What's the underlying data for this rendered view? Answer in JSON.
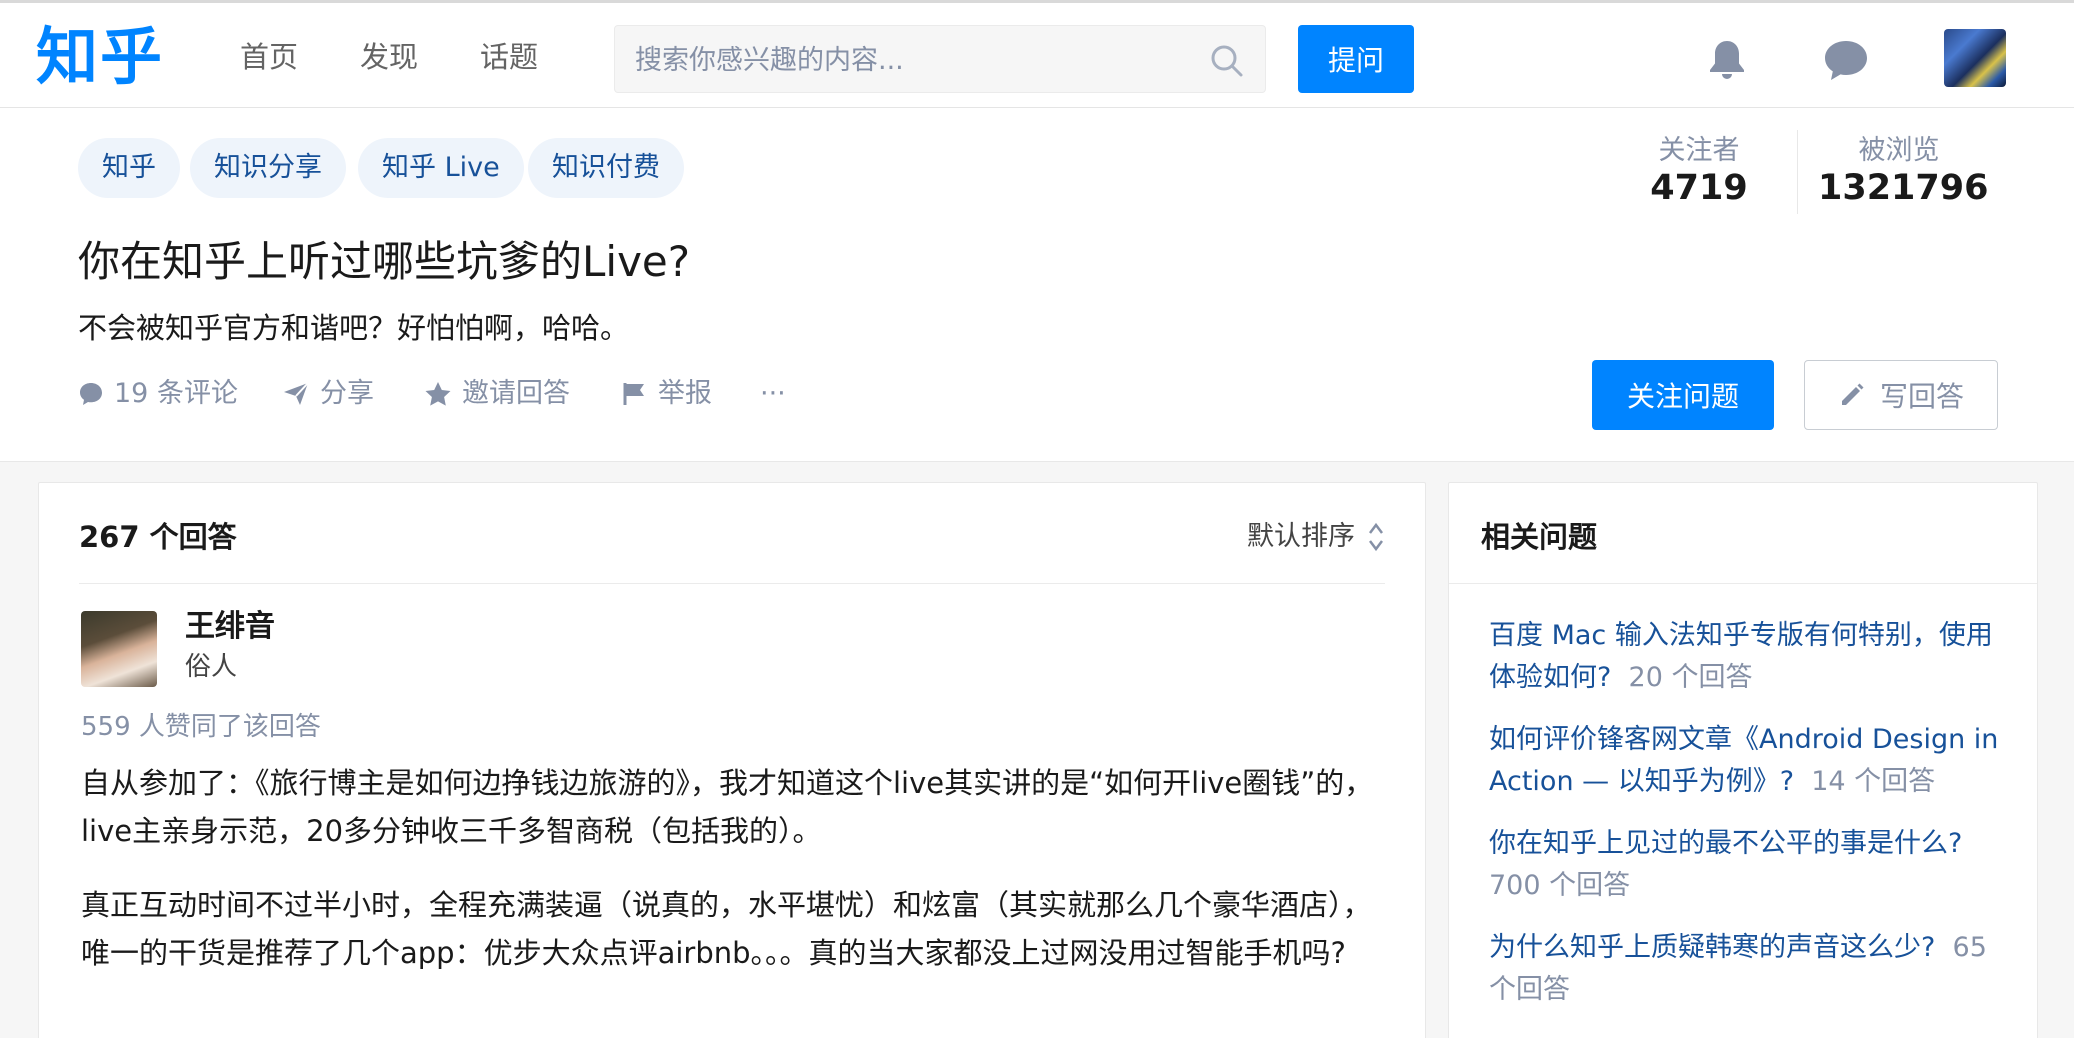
{
  "header": {
    "logo": "知乎",
    "nav": [
      "首页",
      "发现",
      "话题"
    ],
    "search_placeholder": "搜索你感兴趣的内容...",
    "ask_label": "提问",
    "icons": [
      "search-icon",
      "bell-icon",
      "message-icon"
    ]
  },
  "question": {
    "tags": [
      "知乎",
      "知识分享",
      "知乎 Live",
      "知识付费"
    ],
    "followers_label": "关注者",
    "followers_value": "4719",
    "views_label": "被浏览",
    "views_value": "1321796",
    "title": "你在知乎上听过哪些坑爹的Live?",
    "description": "不会被知乎官方和谐吧？好怕怕啊，哈哈。",
    "actions": {
      "comments": "19 条评论",
      "share": "分享",
      "invite": "邀请回答",
      "report": "举报",
      "more": "···"
    },
    "follow_label": "关注问题",
    "write_label": "写回答"
  },
  "answers": {
    "count_label": "267 个回答",
    "sort_label": "默认排序",
    "first": {
      "author_name": "王绯音",
      "author_bio": "俗人",
      "votes": "559 人赞同了该回答",
      "paragraphs": [
        "自从参加了：《旅行博主是如何边挣钱边旅游的》，我才知道这个live其实讲的是“如何开live圈钱”的，live主亲身示范，20多分钟收三千多智商税（包括我的）。",
        "真正互动时间不过半小时，全程充满装逼（说真的，水平堪忧）和炫富（其实就那么几个豪华酒店），唯一的干货是推荐了几个app：优步大众点评airbnb。。。真的当大家都没上过网没用过智能手机吗?"
      ]
    }
  },
  "related": {
    "title": "相关问题",
    "items": [
      {
        "question": "百度 Mac 输入法知乎专版有何特别，使用体验如何?",
        "count": "20 个回答"
      },
      {
        "question": "如何评价锋客网文章《Android Design in Action — 以知乎为例》?",
        "count": "14 个回答"
      },
      {
        "question": "你在知乎上见过的最不公平的事是什么?",
        "count": "700 个回答"
      },
      {
        "question": "为什么知乎上质疑韩寒的声音这么少?",
        "count": "65 个回答"
      }
    ]
  },
  "colors": {
    "brand_blue": "#0084ff",
    "link_blue": "#175199",
    "tag_bg": "#eef4fb",
    "meta_gray": "#8590a6"
  }
}
